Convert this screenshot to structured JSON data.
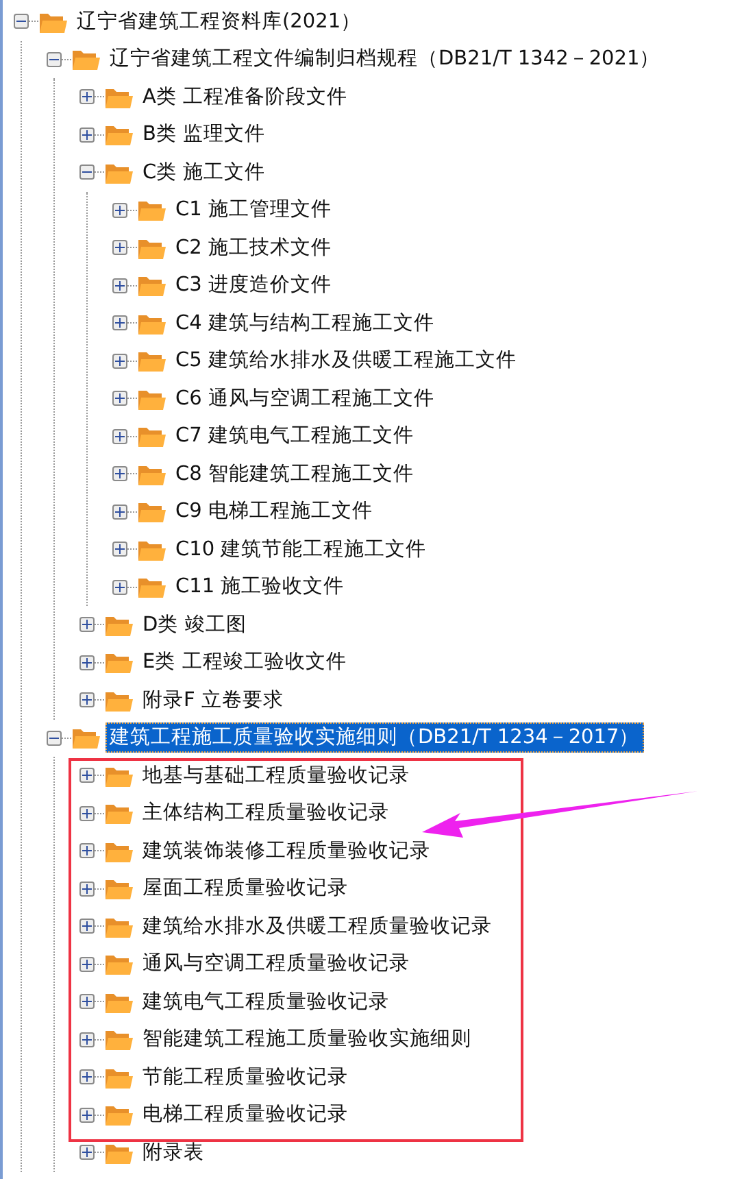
{
  "tree": [
    {
      "label": "辽宁省建筑工程资料库(2021）",
      "expanded": true,
      "selected": false,
      "children": [
        {
          "label": "辽宁省建筑工程文件编制归档规程（DB21/T 1342－2021）",
          "expanded": true,
          "selected": false,
          "children": [
            {
              "label": "A类 工程准备阶段文件",
              "expanded": false,
              "selected": false
            },
            {
              "label": "B类 监理文件",
              "expanded": false,
              "selected": false
            },
            {
              "label": "C类 施工文件",
              "expanded": true,
              "selected": false,
              "children": [
                {
                  "label": "C1 施工管理文件",
                  "expanded": false,
                  "selected": false
                },
                {
                  "label": "C2 施工技术文件",
                  "expanded": false,
                  "selected": false
                },
                {
                  "label": "C3 进度造价文件",
                  "expanded": false,
                  "selected": false
                },
                {
                  "label": "C4 建筑与结构工程施工文件",
                  "expanded": false,
                  "selected": false
                },
                {
                  "label": "C5 建筑给水排水及供暖工程施工文件",
                  "expanded": false,
                  "selected": false
                },
                {
                  "label": "C6 通风与空调工程施工文件",
                  "expanded": false,
                  "selected": false
                },
                {
                  "label": "C7 建筑电气工程施工文件",
                  "expanded": false,
                  "selected": false
                },
                {
                  "label": "C8 智能建筑工程施工文件",
                  "expanded": false,
                  "selected": false
                },
                {
                  "label": "C9 电梯工程施工文件",
                  "expanded": false,
                  "selected": false
                },
                {
                  "label": "C10 建筑节能工程施工文件",
                  "expanded": false,
                  "selected": false
                },
                {
                  "label": "C11 施工验收文件",
                  "expanded": false,
                  "selected": false
                }
              ]
            },
            {
              "label": "D类 竣工图",
              "expanded": false,
              "selected": false
            },
            {
              "label": "E类 工程竣工验收文件",
              "expanded": false,
              "selected": false
            },
            {
              "label": "附录F 立卷要求",
              "expanded": false,
              "selected": false
            }
          ]
        },
        {
          "label": "建筑工程施工质量验收实施细则（DB21/T 1234－2017）",
          "expanded": true,
          "selected": true,
          "children": [
            {
              "label": "地基与基础工程质量验收记录",
              "expanded": false,
              "selected": false
            },
            {
              "label": "主体结构工程质量验收记录",
              "expanded": false,
              "selected": false
            },
            {
              "label": "建筑装饰装修工程质量验收记录",
              "expanded": false,
              "selected": false
            },
            {
              "label": "屋面工程质量验收记录",
              "expanded": false,
              "selected": false
            },
            {
              "label": "建筑给水排水及供暖工程质量验收记录",
              "expanded": false,
              "selected": false
            },
            {
              "label": "通风与空调工程质量验收记录",
              "expanded": false,
              "selected": false
            },
            {
              "label": "建筑电气工程质量验收记录",
              "expanded": false,
              "selected": false
            },
            {
              "label": "智能建筑工程施工质量验收实施细则",
              "expanded": false,
              "selected": false
            },
            {
              "label": "节能工程质量验收记录",
              "expanded": false,
              "selected": false
            },
            {
              "label": "电梯工程质量验收记录",
              "expanded": false,
              "selected": false
            },
            {
              "label": "附录表",
              "expanded": false,
              "selected": false
            }
          ]
        }
      ]
    }
  ]
}
